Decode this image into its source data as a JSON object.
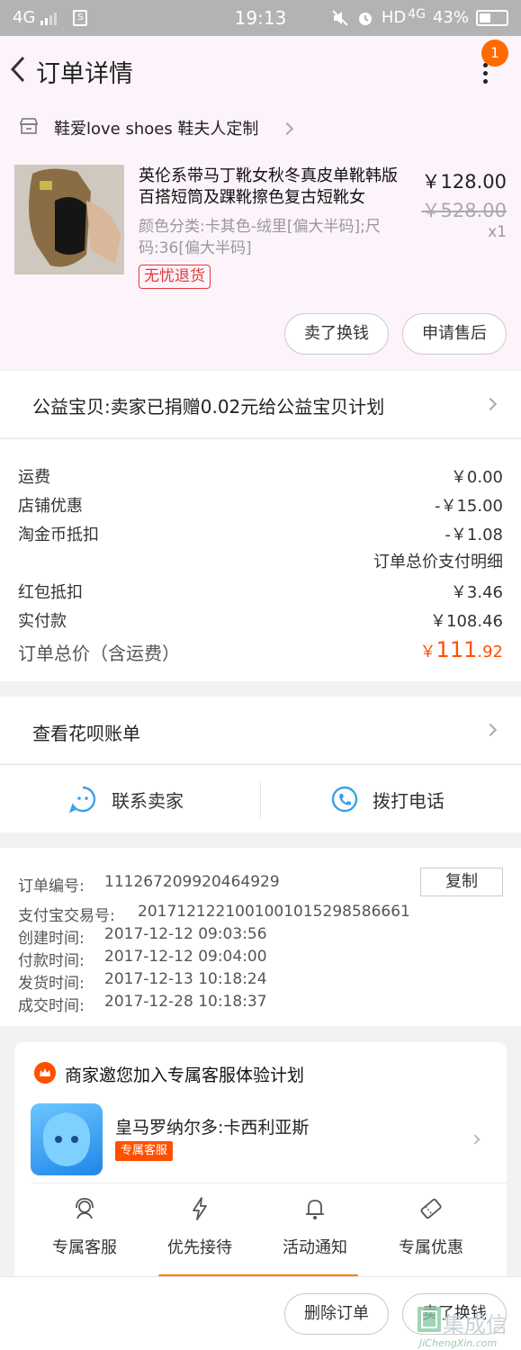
{
  "status_bar": {
    "network": "4G",
    "time": "19:13",
    "hd_label": "HD",
    "network2": "4G",
    "battery_text": "43%",
    "battery_level": 0.43
  },
  "nav": {
    "title": "订单详情",
    "badge": "1"
  },
  "shop": {
    "name": "鞋爱love shoes 鞋夫人定制"
  },
  "product": {
    "title": "英伦系带马丁靴女秋冬真皮单靴韩版百搭短筒及踝靴擦色复古短靴女",
    "sku": "颜色分类:卡其色-绒里[偏大半码];尺码:36[偏大半码]",
    "tag": "无忧退货",
    "price": "￥128.00",
    "original_price": "￥528.00",
    "quantity": "x1"
  },
  "item_buttons": {
    "resell": "卖了换钱",
    "after_sales": "申请售后"
  },
  "charity": {
    "text": "公益宝贝:卖家已捐赠0.02元给公益宝贝计划"
  },
  "fees": {
    "shipping_label": "运费",
    "shipping_value": "￥0.00",
    "shop_discount_label": "店铺优惠",
    "shop_discount_value": "-￥15.00",
    "coin_label": "淘金币抵扣",
    "coin_value": "-￥1.08",
    "payment_detail_link": "订单总价支付明细",
    "redpacket_label": "红包抵扣",
    "redpacket_value": "￥3.46",
    "paid_label": "实付款",
    "paid_value": "￥108.46",
    "total_label": "订单总价（含运费）",
    "total_currency": "￥",
    "total_int": "111",
    "total_dec": ".92"
  },
  "huabei": {
    "text": "查看花呗账单"
  },
  "contact": {
    "seller": "联系卖家",
    "phone": "拨打电话"
  },
  "order_info": {
    "order_no_label": "订单编号:",
    "order_no": "111267209920464929",
    "copy_button": "复制",
    "alipay_label": "支付宝交易号:",
    "alipay_no": "2017121221001001015298586661",
    "created_label": "创建时间:",
    "created": "2017-12-12 09:03:56",
    "paid_label": "付款时间:",
    "paid": "2017-12-12 09:04:00",
    "shipped_label": "发货时间:",
    "shipped": "2017-12-13 10:18:24",
    "closed_label": "成交时间:",
    "closed": "2017-12-28 10:18:37"
  },
  "service_card": {
    "title": "商家邀您加入专属客服体验计划",
    "agent_name": "皇马罗纳尔多:卡西利亚斯",
    "agent_tag": "专属客服",
    "features": [
      {
        "label": "专属客服",
        "icon": "headset-icon"
      },
      {
        "label": "优先接待",
        "icon": "lightning-icon"
      },
      {
        "label": "活动通知",
        "icon": "bell-icon"
      },
      {
        "label": "专属优惠",
        "icon": "ticket-icon"
      }
    ]
  },
  "bottom_bar": {
    "delete_order": "删除订单",
    "resell": "卖了换钱"
  },
  "watermark": {
    "text": "集成信",
    "small": "JiChengXin.com"
  }
}
